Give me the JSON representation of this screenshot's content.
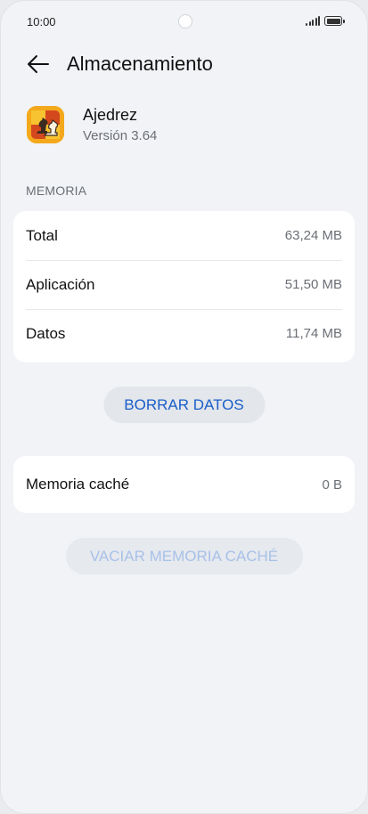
{
  "status_bar": {
    "time": "10:00"
  },
  "header": {
    "title": "Almacenamiento",
    "back_icon": "arrow-left-icon"
  },
  "app": {
    "name": "Ajedrez",
    "version": "Versión 3.64",
    "icon": "chess-app-icon"
  },
  "memory": {
    "section_label": "MEMORIA",
    "rows": [
      {
        "label": "Total",
        "value": "63,24 MB"
      },
      {
        "label": "Aplicación",
        "value": "51,50 MB"
      },
      {
        "label": "Datos",
        "value": "11,74 MB"
      }
    ],
    "clear_data_label": "BORRAR DATOS"
  },
  "cache": {
    "label": "Memoria caché",
    "value": "0 B",
    "clear_cache_label": "VACIAR MEMORIA CACHÉ",
    "clear_cache_enabled": false
  },
  "colors": {
    "accent": "#1a5fc9",
    "disabled_accent": "#a8c1e8",
    "background": "#f1f3f6"
  }
}
